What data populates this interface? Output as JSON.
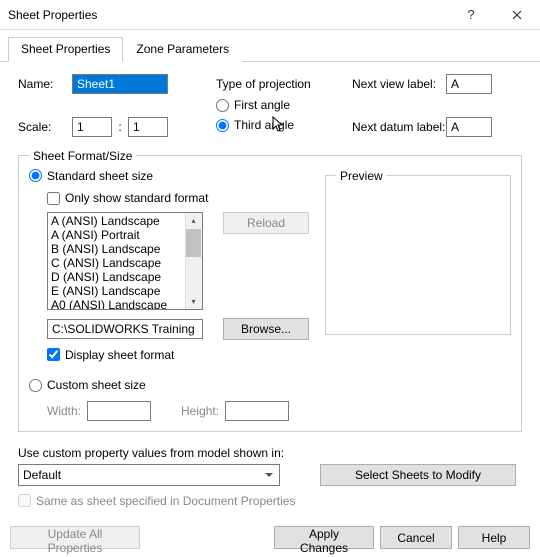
{
  "window": {
    "title": "Sheet Properties"
  },
  "tabs": {
    "t0": "Sheet Properties",
    "t1": "Zone Parameters"
  },
  "fields": {
    "name_label": "Name:",
    "name_value": "Sheet1",
    "scale_label": "Scale:",
    "scale_a": "1",
    "scale_colon": ":",
    "scale_b": "1",
    "proj_label": "Type of projection",
    "first_angle": "First angle",
    "third_angle": "Third angle",
    "next_view_label": "Next view label:",
    "next_view_value": "A",
    "next_datum_label": "Next datum label:",
    "next_datum_value": "A"
  },
  "format": {
    "legend": "Sheet Format/Size",
    "standard_label": "Standard sheet size",
    "only_standard": "Only show standard format",
    "sizes": {
      "s0": "A (ANSI) Landscape",
      "s1": "A (ANSI) Portrait",
      "s2": "B (ANSI) Landscape",
      "s3": "C (ANSI) Landscape",
      "s4": "D (ANSI) Landscape",
      "s5": "E (ANSI) Landscape",
      "s6": "A0 (ANSI) Landscape"
    },
    "reload": "Reload",
    "path": "C:\\SOLIDWORKS Training Fi",
    "browse": "Browse...",
    "display_sheet_format": "Display sheet format",
    "preview": "Preview",
    "custom_label": "Custom sheet size",
    "width_label": "Width:",
    "height_label": "Height:"
  },
  "bottom": {
    "use_custom_label": "Use custom property values from model shown in:",
    "model": "Default",
    "select_sheets": "Select Sheets to Modify",
    "same_as": "Same as sheet specified in Document Properties"
  },
  "footer": {
    "update_all": "Update All Properties",
    "apply": "Apply Changes",
    "cancel": "Cancel",
    "help": "Help"
  }
}
